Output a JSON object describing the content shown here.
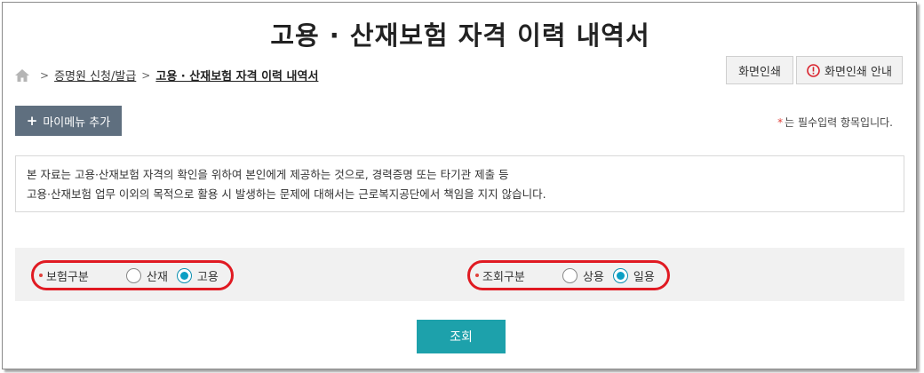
{
  "page": {
    "title": "고용 · 산재보험 자격 이력 내역서"
  },
  "breadcrumb": {
    "home_icon": "home-icon",
    "link": "증명원 신청/발급",
    "current": "고용 · 산재보험 자격 이력 내역서"
  },
  "toolbar": {
    "print_label": "화면인쇄",
    "print_guide_label": "화면인쇄 안내",
    "print_guide_icon": "warning-circle-icon",
    "mymenu_label": "마이메뉴 추가"
  },
  "required_note": {
    "star": "*",
    "text": "는 필수입력 항목입니다."
  },
  "notice": {
    "line1": "본 자료는 고용·산재보험 자격의 확인을 위하여 본인에게 제공하는 것으로, 경력증명 또는 타기관 제출 등",
    "line2": "고용·산재보험 업무 이외의 목적으로 활용 시 발생하는 문제에 대해서는 근로복지공단에서 책임을 지지 않습니다."
  },
  "filters": {
    "insurance": {
      "label": "보험구분",
      "options": [
        {
          "label": "산재",
          "checked": false
        },
        {
          "label": "고용",
          "checked": true
        }
      ]
    },
    "query": {
      "label": "조회구분",
      "options": [
        {
          "label": "상용",
          "checked": false
        },
        {
          "label": "일용",
          "checked": true
        }
      ]
    }
  },
  "search_button": {
    "label": "조회"
  },
  "colors": {
    "accent_teal": "#1da1ab",
    "radio_checked": "#0b9fc4",
    "highlight_red": "#e01a22",
    "mymenu_bg": "#5f6f7f"
  }
}
